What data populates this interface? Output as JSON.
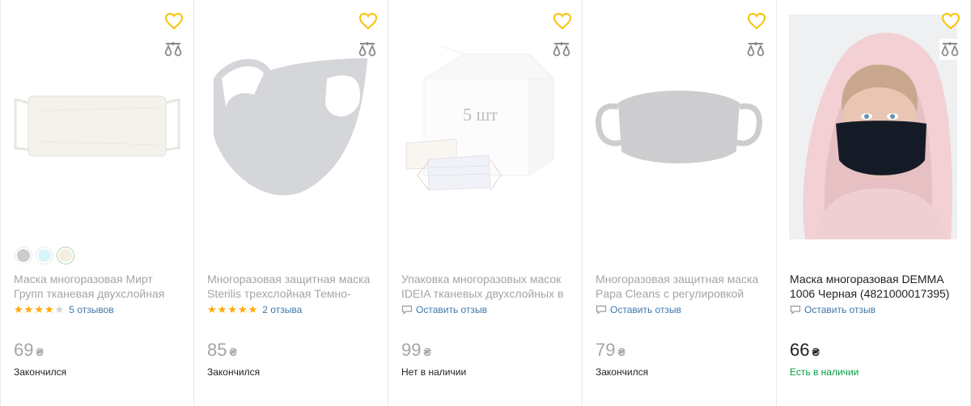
{
  "colors": {
    "accent_star": "#ffa900",
    "heart": "#f8c200",
    "link": "#3e77aa",
    "in_stock": "#00a046",
    "muted": "#a6a5a5"
  },
  "icons": {
    "favorite": "heart-icon",
    "compare": "scales-icon",
    "review": "speech-bubble-icon"
  },
  "products": [
    {
      "title": "Маска многоразовая Мирт Групп тканевая двухслойная",
      "price": "69",
      "currency": "₴",
      "status": "Закончился",
      "rating": 4,
      "reviews": "5 отзывов",
      "swatches": [
        "#a4a4a4",
        "#b9f0f5",
        "#e8e1c8"
      ],
      "available": false
    },
    {
      "title": "Многоразовая защитная маска Sterilis трехслойная Темно-",
      "price": "85",
      "currency": "₴",
      "status": "Закончился",
      "rating": 5,
      "reviews": "2 отзыва",
      "available": false
    },
    {
      "title": "Упаковка многоразовых масок IDEIA тканевых двухслойных в",
      "price": "99",
      "currency": "₴",
      "status": "Нет в наличии",
      "leave_review": "Оставить отзыв",
      "box_label": "5 шт",
      "available": false
    },
    {
      "title": "Многоразовая защитная маска Papa Cleans с регулировкой",
      "price": "79",
      "currency": "₴",
      "status": "Закончился",
      "leave_review": "Оставить отзыв",
      "available": false
    },
    {
      "title": "Маска многоразовая DEMMA 1006 Черная (4821000017395)",
      "price": "66",
      "currency": "₴",
      "status": "Есть в наличии",
      "leave_review": "Оставить отзыв",
      "available": true
    }
  ]
}
